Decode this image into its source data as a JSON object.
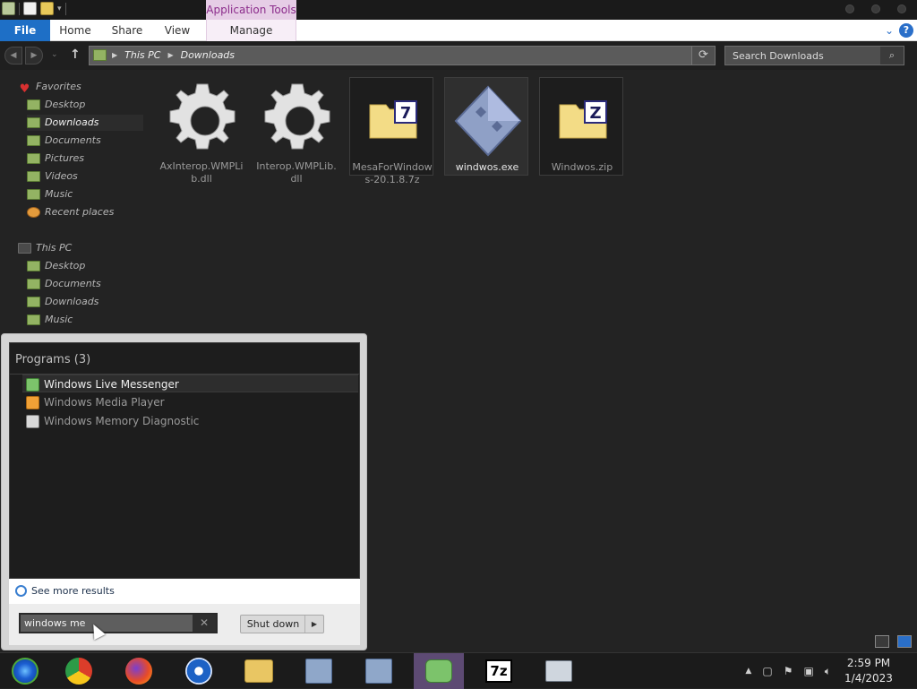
{
  "titlebar": {
    "app_tools": "Application Tools"
  },
  "ribbon": {
    "tabs": [
      {
        "label": "File"
      },
      {
        "label": "Home"
      },
      {
        "label": "Share"
      },
      {
        "label": "View"
      },
      {
        "label": "Manage"
      }
    ]
  },
  "address": {
    "crumbs": [
      "This PC",
      "Downloads"
    ],
    "search_placeholder": "Search Downloads"
  },
  "navpane": {
    "favorites_label": "Favorites",
    "favorites": [
      "Desktop",
      "Downloads",
      "Documents",
      "Pictures",
      "Videos",
      "Music",
      "Recent places"
    ],
    "selected": "Downloads",
    "thispc_label": "This PC",
    "thispc": [
      "Desktop",
      "Documents",
      "Downloads",
      "Music"
    ]
  },
  "files": [
    {
      "name": "AxInterop.WMPLib.dll",
      "icon": "gear-icon"
    },
    {
      "name": "Interop.WMPLib.dll",
      "icon": "gear-icon"
    },
    {
      "name": "MesaForWindows-20.1.8.7z",
      "icon": "7z-archive-icon"
    },
    {
      "name": "windwos.exe",
      "icon": "exe-icon",
      "selected": true
    },
    {
      "name": "Windwos.zip",
      "icon": "zip-archive-icon"
    }
  ],
  "startmenu": {
    "heading": "Programs (3)",
    "programs": [
      {
        "label": "Windows Live Messenger",
        "icon": "messenger-icon",
        "highlighted": true
      },
      {
        "label": "Windows Media Player",
        "icon": "media-player-icon"
      },
      {
        "label": "Windows Memory Diagnostic",
        "icon": "memory-diagnostic-icon"
      }
    ],
    "see_more": "See more results",
    "search_value": "windows me",
    "shutdown_label": "Shut down"
  },
  "taskbar": {
    "apps": [
      "start-orb",
      "chrome",
      "firefox",
      "opera",
      "file-explorer",
      "installer",
      "installer-2",
      "windows-live-messenger",
      "7-zip",
      "performance-monitor"
    ],
    "active_app": "windows-live-messenger",
    "time": "2:59 PM",
    "date": "1/4/2023"
  },
  "colors": {
    "file_tab": "#1e6fc6",
    "app_tools_bg": "#e6cde6",
    "app_tools_text": "#8b2b8b",
    "taskbar_active": "#5d4a73"
  }
}
